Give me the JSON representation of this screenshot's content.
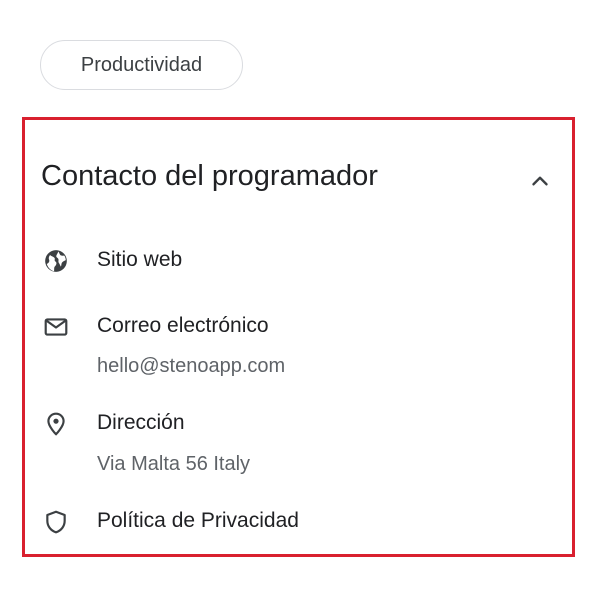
{
  "chip": {
    "label": "Productividad"
  },
  "developer_contact": {
    "title": "Contacto del programador",
    "items": [
      {
        "label": "Sitio web",
        "icon": "globe-icon"
      },
      {
        "label": "Correo electrónico",
        "value": "hello@stenoapp.com",
        "icon": "mail-icon"
      },
      {
        "label": "Dirección",
        "value": "Via Malta 56 Italy",
        "icon": "location-pin-icon"
      },
      {
        "label": "Política de Privacidad",
        "icon": "shield-icon"
      }
    ]
  },
  "colors": {
    "highlight_border": "#d9202f",
    "primary_text": "#202124",
    "secondary_text": "#5f6368",
    "chip_border": "#dadce0"
  }
}
